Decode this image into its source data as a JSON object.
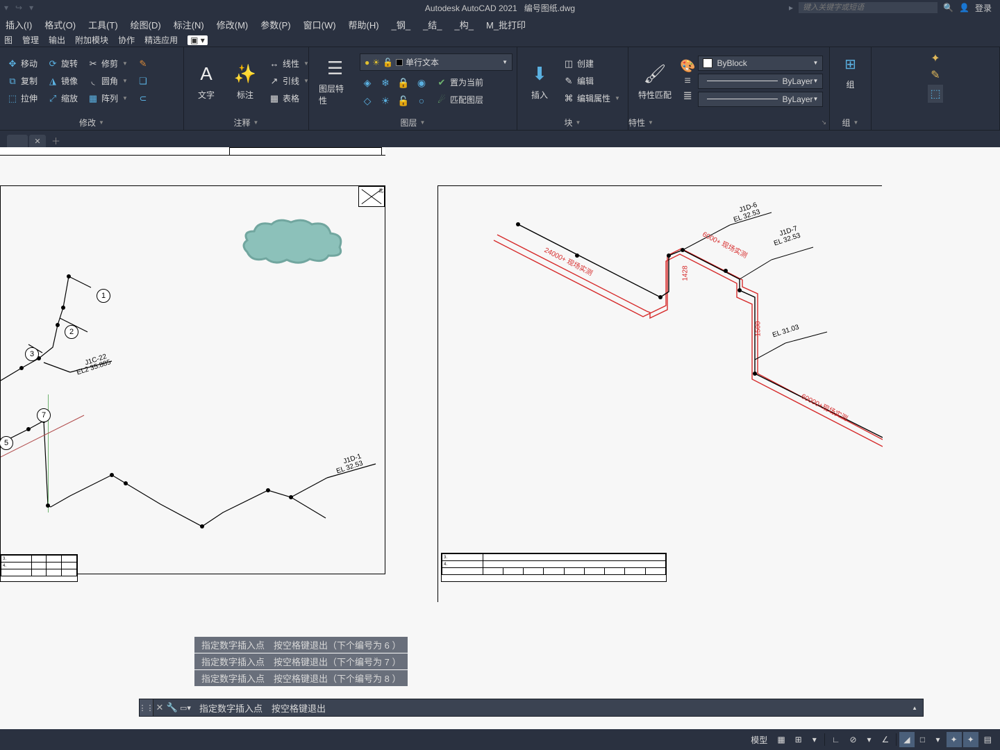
{
  "title": {
    "app": "Autodesk AutoCAD 2021",
    "file": "编号图纸.dwg"
  },
  "search_placeholder": "键入关键字或短语",
  "login_label": "登录",
  "menu": [
    "插入(I)",
    "格式(O)",
    "工具(T)",
    "绘图(D)",
    "标注(N)",
    "修改(M)",
    "参数(P)",
    "窗口(W)",
    "帮助(H)",
    "_钢_",
    "_结_",
    "_构_",
    "M_批打印"
  ],
  "tabs": [
    "图",
    "管理",
    "输出",
    "附加模块",
    "协作",
    "精选应用"
  ],
  "ribbon": {
    "modify": {
      "title": "修改",
      "move": "移动",
      "rotate": "旋转",
      "trim": "修剪",
      "copy": "复制",
      "mirror": "镜像",
      "fillet": "圆角",
      "stretch": "拉伸",
      "scale": "缩放",
      "array": "阵列"
    },
    "annotate": {
      "title": "注释",
      "text": "文字",
      "dim": "标注",
      "linear": "线性",
      "leader": "引线",
      "table": "表格"
    },
    "layer": {
      "title": "图层",
      "props": "图层特性",
      "textstyle": "单行文本",
      "setcurrent": "置为当前",
      "match": "匹配图层"
    },
    "block": {
      "ins": "插入",
      "create": "创建",
      "edit": "编辑",
      "attr": "编辑属性",
      "title": "块"
    },
    "props": {
      "match": "特性匹配",
      "byblock": "ByBlock",
      "bylayer1": "ByLayer",
      "bylayer2": "ByLayer",
      "title": "特性"
    },
    "group": {
      "label": "组",
      "title": "组"
    }
  },
  "drawing": {
    "bubbles": {
      "b1": "1",
      "b2": "2",
      "b3": "3",
      "b7": "7",
      "b5": "5"
    },
    "annos": {
      "j1c22_a": "J1C-22",
      "j1c22_b": "EL2 35.885",
      "j1d1_a": "J1D-1",
      "j1d1_b": "EL 32.53",
      "j1d6_a": "J1D-6",
      "j1d6_b": "EL 32.53",
      "j1d7_a": "J1D-7",
      "j1d7_b": "EL 32.53",
      "el31": "EL 31.03",
      "d24000": "24000+ 现场实测",
      "d6000": "6000+ 现场实测",
      "d60000": "60000+现场实测",
      "d1428": "1428",
      "d1500": "1500"
    }
  },
  "history": [
    "指定数字插入点　按空格键退出（下个编号为 6 ）",
    "指定数字插入点　按空格键退出（下个编号为 7 ）",
    "指定数字插入点　按空格键退出（下个编号为 8 ）"
  ],
  "cmd": {
    "prompt": "指定数字插入点　按空格键退出"
  },
  "status": {
    "model": "模型"
  }
}
